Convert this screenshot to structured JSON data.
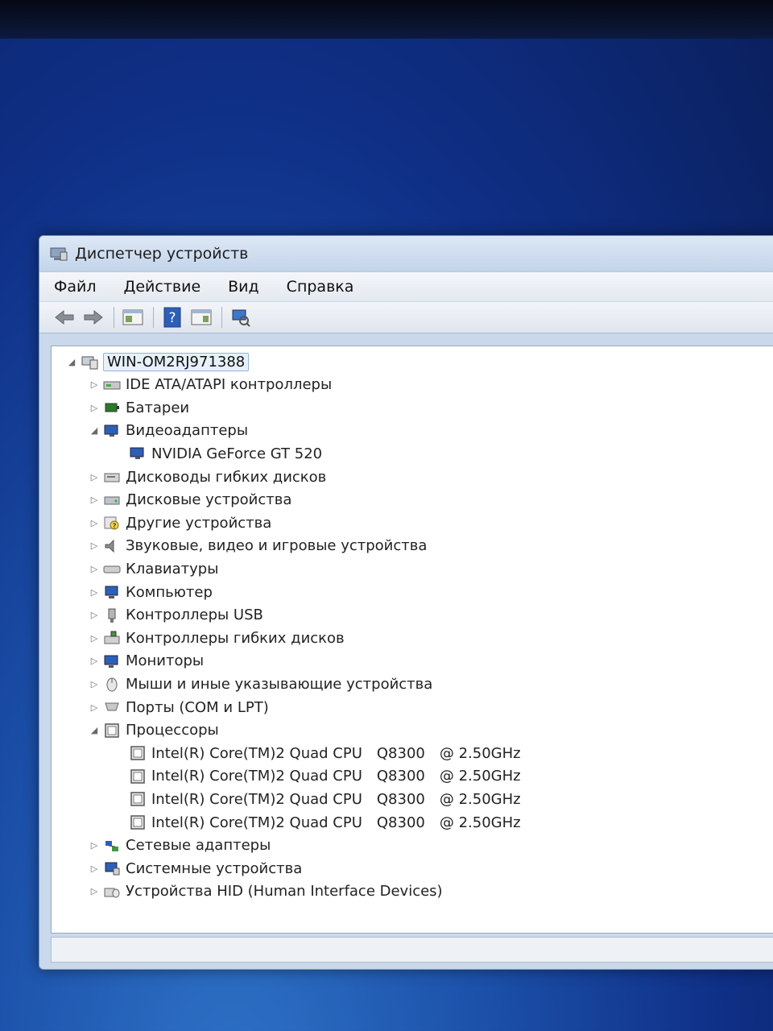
{
  "window": {
    "title": "Диспетчер устройств"
  },
  "menu": [
    "Файл",
    "Действие",
    "Вид",
    "Справка"
  ],
  "toolbar": {
    "icons": [
      "back-arrow-icon",
      "forward-arrow-icon",
      "properties-icon",
      "help-icon",
      "view-icon",
      "scan-hardware-icon"
    ]
  },
  "tree": {
    "root": "WIN-OM2RJ971388",
    "categories": [
      {
        "label": "IDE ATA/ATAPI контроллеры",
        "expanded": false
      },
      {
        "label": "Батареи",
        "expanded": false
      },
      {
        "label": "Видеоадаптеры",
        "expanded": true,
        "children": [
          "NVIDIA GeForce GT 520"
        ]
      },
      {
        "label": "Дисководы гибких дисков",
        "expanded": false
      },
      {
        "label": "Дисковые устройства",
        "expanded": false
      },
      {
        "label": "Другие устройства",
        "expanded": false
      },
      {
        "label": "Звуковые, видео и игровые устройства",
        "expanded": false
      },
      {
        "label": "Клавиатуры",
        "expanded": false
      },
      {
        "label": "Компьютер",
        "expanded": false
      },
      {
        "label": "Контроллеры USB",
        "expanded": false
      },
      {
        "label": "Контроллеры гибких дисков",
        "expanded": false
      },
      {
        "label": "Мониторы",
        "expanded": false
      },
      {
        "label": "Мыши и иные указывающие устройства",
        "expanded": false
      },
      {
        "label": "Порты (COM и LPT)",
        "expanded": false
      },
      {
        "label": "Процессоры",
        "expanded": true,
        "children": [
          {
            "name": "Intel(R) Core(TM)2 Quad CPU",
            "model": "Q8300",
            "speed": "@ 2.50GHz"
          },
          {
            "name": "Intel(R) Core(TM)2 Quad CPU",
            "model": "Q8300",
            "speed": "@ 2.50GHz"
          },
          {
            "name": "Intel(R) Core(TM)2 Quad CPU",
            "model": "Q8300",
            "speed": "@ 2.50GHz"
          },
          {
            "name": "Intel(R) Core(TM)2 Quad CPU",
            "model": "Q8300",
            "speed": "@ 2.50GHz"
          }
        ]
      },
      {
        "label": "Сетевые адаптеры",
        "expanded": false
      },
      {
        "label": "Системные устройства",
        "expanded": false
      },
      {
        "label": "Устройства HID (Human Interface Devices)",
        "expanded": false
      }
    ]
  }
}
